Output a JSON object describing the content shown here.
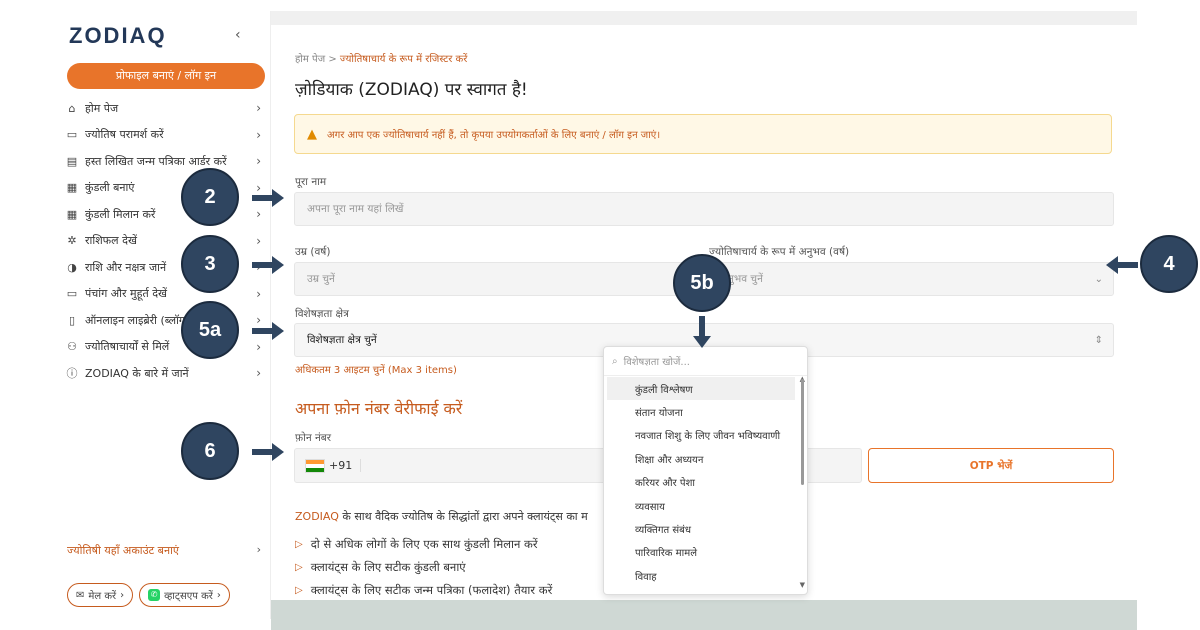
{
  "sidebar": {
    "logo": "ZODIAQ",
    "collapse_icon": "‹",
    "profile_button": "प्रोफाइल बनाएं / लॉग इन",
    "items": [
      {
        "icon": "home-icon",
        "glyph": "⌂",
        "label": "होम पेज"
      },
      {
        "icon": "chat-icon",
        "glyph": "▭",
        "label": "ज्योतिष परामर्श करें"
      },
      {
        "icon": "document-icon",
        "glyph": "▤",
        "label": "हस्त लिखित जन्म पत्रिका आर्डर करें"
      },
      {
        "icon": "grid-icon",
        "glyph": "▦",
        "label": "कुंडली बनाएं"
      },
      {
        "icon": "grid-icon",
        "glyph": "▦",
        "label": "कुंडली मिलान करें"
      },
      {
        "icon": "zodiac-wheel-icon",
        "glyph": "✲",
        "label": "राशिफल देखें"
      },
      {
        "icon": "half-circle-icon",
        "glyph": "◑",
        "label": "राशि और नक्षत्र जानें"
      },
      {
        "icon": "calendar-icon",
        "glyph": "▭",
        "label": "पंचांग और मुहूर्त देखें"
      },
      {
        "icon": "book-icon",
        "glyph": "▯",
        "label": "ऑनलाइन लाइब्रेरी (ब्लॉग)"
      },
      {
        "icon": "users-icon",
        "glyph": "⚇",
        "label": "ज्योतिषाचार्यों से मिलें"
      },
      {
        "icon": "info-icon",
        "glyph": "ⓘ",
        "label": "ZODIAQ के बारे में जानें"
      }
    ],
    "astrologer_link": "ज्योतिषी यहाँ अकाउंट बनाएं",
    "mail_button": "मेल करें",
    "whatsapp_button": "व्हाट्सएप करें"
  },
  "main": {
    "breadcrumb_home": "होम पेज >",
    "breadcrumb_current": "ज्योतिषाचार्य के रूप में रजिस्टर करें",
    "title": "ज़ोडियाक (ZODIAQ) पर स्वागत है!",
    "alert": "अगर आप एक ज्योतिषाचार्य नहीं हैं, तो कृपया उपयोगकर्ताओं के लिए बनाएं / लॉग इन जाएं।",
    "name_label": "पूरा नाम",
    "name_placeholder": "अपना पूरा नाम यहां लिखें",
    "age_label": "उम्र (वर्ष)",
    "age_placeholder": "उम्र चुनें",
    "exp_label": "ज्योतिषाचार्य के रूप में अनुभव (वर्ष)",
    "exp_placeholder": "अनुभव चुनें",
    "spec_label": "विशेषज्ञता क्षेत्र",
    "spec_value": "विशेषज्ञता क्षेत्र चुनें",
    "spec_limit": "अधिकतम 3 आइटम चुनें (Max 3 items)",
    "verify_title": "अपना फ़ोन नंबर वेरीफाई करें",
    "phone_label": "फ़ोन नंबर",
    "phone_code": "+91",
    "otp_button": "OTP भेजें",
    "promo_brand": "ZODIAQ",
    "promo_text": " के साथ वैदिक ज्योतिष के सिद्धांतों द्वारा अपने क्लायंट्स का म",
    "benefits": [
      "दो से अधिक लोगों के लिए एक साथ कुंडली मिलान करें",
      "क्लायंट्स के लिए सटीक कुंडली बनाएं",
      "क्लायंट्स के लिए सटीक जन्म पत्रिका (फलादेश) तैयार करें"
    ]
  },
  "dropdown": {
    "search_placeholder": "विशेषज्ञता खोजें...",
    "options": [
      "कुंडली विश्लेषण",
      "संतान योजना",
      "नवजात शिशु के लिए जीवन भविष्यवाणी",
      "शिक्षा और अध्ययन",
      "करियर और पेशा",
      "व्यवसाय",
      "व्यक्तिगत संबंध",
      "पारिवारिक मामले",
      "विवाह"
    ]
  },
  "markers": [
    "2",
    "3",
    "4",
    "5a",
    "5b",
    "6"
  ],
  "colors": {
    "accent": "#e8742a",
    "navy": "#2f4560",
    "alert_bg": "#fff8e6"
  }
}
